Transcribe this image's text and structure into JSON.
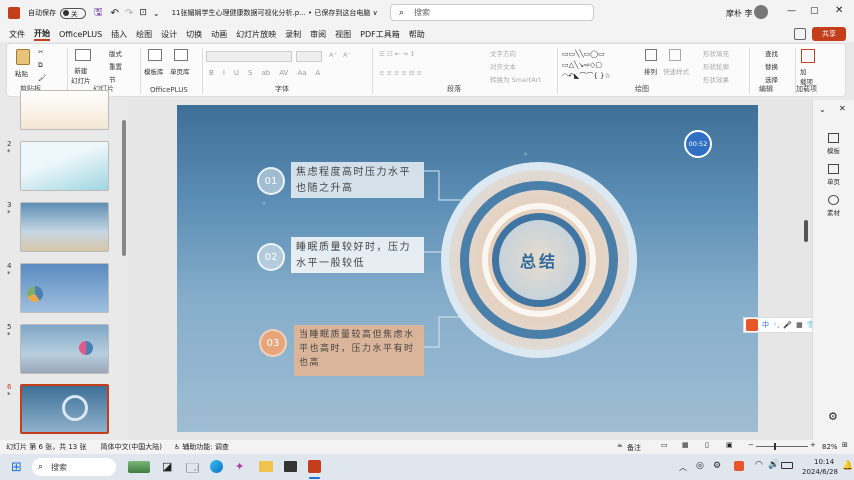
{
  "titlebar": {
    "autosave_label": "自动保存",
    "autosave_state": "关",
    "doc_title": "11张媚娴学生心理健康数据可视化分析.p... • 已保存到这台电脑 ∨",
    "search_placeholder": "搜索",
    "user_name": "摩朴 李"
  },
  "menu": [
    "文件",
    "开始",
    "OfficePLUS",
    "插入",
    "绘图",
    "设计",
    "切换",
    "动画",
    "幻灯片放映",
    "录制",
    "审阅",
    "视图",
    "PDF工具箱",
    "帮助"
  ],
  "menu_active_index": 1,
  "share_label": "共享",
  "ribbon": {
    "paste": "粘贴",
    "new_slide": "新建\n幻灯片",
    "layout": "版式",
    "reset": "重置",
    "section": "节",
    "template": "模板库",
    "single_page": "单页库",
    "text_direction": "文字方向",
    "align_text": "对齐文本",
    "smartart": "转换为 SmartArt",
    "arrange": "排列",
    "quick_styles": "快速样式",
    "shape_fill": "形状填充",
    "shape_outline": "形状轮廓",
    "shape_effects": "形状效果",
    "find": "查找",
    "replace": "替换",
    "select": "选择",
    "addin": "加\n载项",
    "groups": {
      "clipboard": "剪贴板",
      "slides": "幻灯片",
      "officeplus": "OfficePLUS",
      "font": "字体",
      "paragraph": "段落",
      "drawing": "绘图",
      "editing": "编辑",
      "addins": "加载项"
    },
    "font_buttons": [
      "B",
      "I",
      "U",
      "S",
      "ab",
      "AV",
      "Aa",
      "A"
    ]
  },
  "thumbnails": [
    {
      "num": "2",
      "star": "*"
    },
    {
      "num": "3",
      "star": "*"
    },
    {
      "num": "4",
      "star": "*"
    },
    {
      "num": "5",
      "star": "*"
    },
    {
      "num": "6",
      "star": "*"
    }
  ],
  "slide": {
    "timer": "00:52",
    "center_title": "总结",
    "items": [
      {
        "num": "01",
        "text": "焦虑程度高时压力水平也随之升高"
      },
      {
        "num": "02",
        "text": "睡眠质量较好时，压力水平一般较低"
      },
      {
        "num": "03",
        "text": "当睡眠质量较高但焦虑水平也高时，压力水平有时也高"
      }
    ]
  },
  "rightpane": {
    "design": "模板",
    "single": "单页",
    "material": "素材"
  },
  "ime": {
    "items": [
      "中",
      "◦,",
      "🎤",
      "▦",
      "👕",
      "⚙"
    ]
  },
  "status": {
    "slide_info": "幻灯片 第 6 张，共 13 张",
    "language": "简体中文(中国大陆)",
    "accessibility": "辅助功能: 调查",
    "notes": "备注",
    "zoom": "82%"
  },
  "taskbar": {
    "search": "搜索",
    "time": "10:14",
    "date": "2024/6/28"
  },
  "colors": {
    "accent": "#c43e1c",
    "slide_blue": "#3f74a3",
    "peach": "#e8b58f"
  }
}
